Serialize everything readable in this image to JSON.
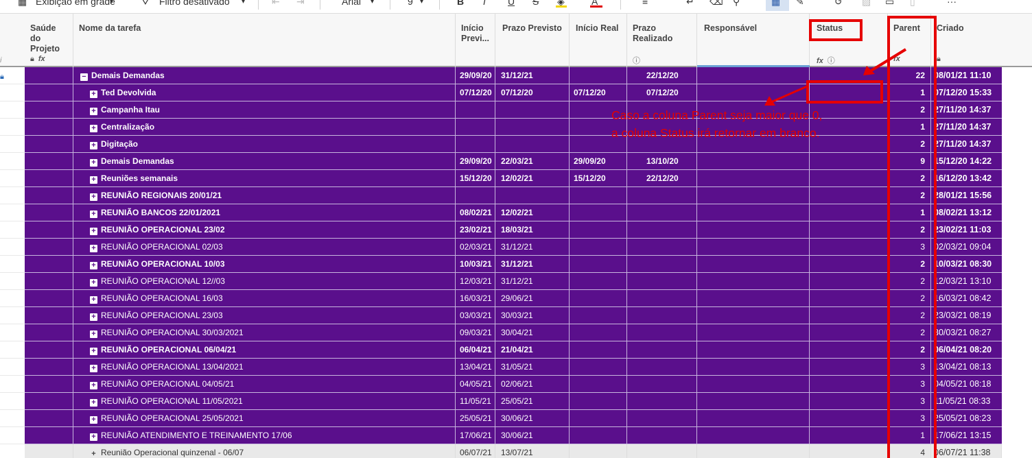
{
  "toolbar": {
    "view_label": "Exibição em grade",
    "filter_label": "Filtro desativado",
    "font_label": "Arial",
    "size_label": "9",
    "bold_label": "B",
    "italic_label": "I",
    "underline_label": "U",
    "strike_label": "S",
    "text_color_label": "A"
  },
  "columns": {
    "saude": "Saúde do Projeto",
    "nome": "Nome da tarefa",
    "inicio_previsto": "Início Previ...",
    "prazo_previsto": "Prazo Previsto",
    "inicio_real": "Início Real",
    "prazo_realizado": "Prazo Realizado",
    "responsavel": "Responsável",
    "status": "Status",
    "parent": "Parent",
    "criado": "Criado"
  },
  "rows": [
    {
      "nome": "Demais Demandas",
      "toggle": "−",
      "inicio": "29/09/20",
      "prazo": "31/12/21",
      "real": "",
      "realizado": "22/12/20",
      "parent": "22",
      "criado": "08/01/21 11:10",
      "bold": true,
      "top": true
    },
    {
      "nome": "Ted Devolvida",
      "toggle": "+",
      "inicio": "07/12/20",
      "prazo": "07/12/20",
      "real": "07/12/20",
      "realizado": "07/12/20",
      "parent": "1",
      "criado": "07/12/20 15:33",
      "bold": true
    },
    {
      "nome": "Campanha Itau",
      "toggle": "+",
      "inicio": "",
      "prazo": "",
      "real": "",
      "realizado": "",
      "parent": "2",
      "criado": "27/11/20 14:37",
      "bold": true
    },
    {
      "nome": "Centralização",
      "toggle": "+",
      "inicio": "",
      "prazo": "",
      "real": "",
      "realizado": "",
      "parent": "1",
      "criado": "27/11/20 14:37",
      "bold": true
    },
    {
      "nome": "Digitação",
      "toggle": "+",
      "inicio": "",
      "prazo": "",
      "real": "",
      "realizado": "",
      "parent": "2",
      "criado": "27/11/20 14:37",
      "bold": true
    },
    {
      "nome": "Demais Demandas",
      "toggle": "+",
      "inicio": "29/09/20",
      "prazo": "22/03/21",
      "real": "29/09/20",
      "realizado": "13/10/20",
      "parent": "9",
      "criado": "15/12/20 14:22",
      "bold": true
    },
    {
      "nome": "Reuniões semanais",
      "toggle": "+",
      "inicio": "15/12/20",
      "prazo": "12/02/21",
      "real": "15/12/20",
      "realizado": "22/12/20",
      "parent": "2",
      "criado": "16/12/20 13:42",
      "bold": true
    },
    {
      "nome": "REUNIÃO REGIONAIS 20/01/21",
      "toggle": "+",
      "inicio": "",
      "prazo": "",
      "real": "",
      "realizado": "",
      "parent": "2",
      "criado": "28/01/21 15:56",
      "bold": true
    },
    {
      "nome": "REUNIÃO BANCOS 22/01/2021",
      "toggle": "+",
      "inicio": "08/02/21",
      "prazo": "12/02/21",
      "real": "",
      "realizado": "",
      "parent": "1",
      "criado": "08/02/21 13:12",
      "bold": true
    },
    {
      "nome": "REUNIÃO OPERACIONAL 23/02",
      "toggle": "+",
      "inicio": "23/02/21",
      "prazo": "18/03/21",
      "real": "",
      "realizado": "",
      "parent": "2",
      "criado": "23/02/21 11:03",
      "bold": true
    },
    {
      "nome": "REUNIÃO OPERACIONAL 02/03",
      "toggle": "+",
      "inicio": "02/03/21",
      "prazo": "31/12/21",
      "real": "",
      "realizado": "",
      "parent": "3",
      "criado": "02/03/21 09:04",
      "bold": false
    },
    {
      "nome": "REUNIÃO OPERACIONAL 10/03",
      "toggle": "+",
      "inicio": "10/03/21",
      "prazo": "31/12/21",
      "real": "",
      "realizado": "",
      "parent": "2",
      "criado": "10/03/21 08:30",
      "bold": true
    },
    {
      "nome": "REUNIÃO OPERACIONAL 12//03",
      "toggle": "+",
      "inicio": "12/03/21",
      "prazo": "31/12/21",
      "real": "",
      "realizado": "",
      "parent": "2",
      "criado": "12/03/21 13:10",
      "bold": false
    },
    {
      "nome": "REUNIÃO OPERACIONAL 16/03",
      "toggle": "+",
      "inicio": "16/03/21",
      "prazo": "29/06/21",
      "real": "",
      "realizado": "",
      "parent": "2",
      "criado": "16/03/21 08:42",
      "bold": false
    },
    {
      "nome": "REUNIÃO OPERACIONAL 23/03",
      "toggle": "+",
      "inicio": "03/03/21",
      "prazo": "30/03/21",
      "real": "",
      "realizado": "",
      "parent": "2",
      "criado": "23/03/21 08:19",
      "bold": false
    },
    {
      "nome": "REUNIÃO OPERACIONAL 30/03/2021",
      "toggle": "+",
      "inicio": "09/03/21",
      "prazo": "30/04/21",
      "real": "",
      "realizado": "",
      "parent": "2",
      "criado": "30/03/21 08:27",
      "bold": false
    },
    {
      "nome": "REUNIÃO OPERACIONAL 06/04/21",
      "toggle": "+",
      "inicio": "06/04/21",
      "prazo": "21/04/21",
      "real": "",
      "realizado": "",
      "parent": "2",
      "criado": "06/04/21 08:20",
      "bold": true
    },
    {
      "nome": "REUNIÃO OPERACIONAL 13/04/2021",
      "toggle": "+",
      "inicio": "13/04/21",
      "prazo": "31/05/21",
      "real": "",
      "realizado": "",
      "parent": "3",
      "criado": "13/04/21 08:13",
      "bold": false
    },
    {
      "nome": "REUNIÃO OPERACIONAL 04/05/21",
      "toggle": "+",
      "inicio": "04/05/21",
      "prazo": "02/06/21",
      "real": "",
      "realizado": "",
      "parent": "3",
      "criado": "04/05/21 08:18",
      "bold": false
    },
    {
      "nome": "REUNIÃO OPERACIONAL 11/05/2021",
      "toggle": "+",
      "inicio": "11/05/21",
      "prazo": "25/05/21",
      "real": "",
      "realizado": "",
      "parent": "3",
      "criado": "11/05/21 08:33",
      "bold": false
    },
    {
      "nome": "REUNIÃO OPERACIONAL 25/05/2021",
      "toggle": "+",
      "inicio": "25/05/21",
      "prazo": "30/06/21",
      "real": "",
      "realizado": "",
      "parent": "3",
      "criado": "25/05/21 08:23",
      "bold": false
    },
    {
      "nome": "REUNIÃO ATENDIMENTO E TREINAMENTO 17/06",
      "toggle": "+",
      "inicio": "17/06/21",
      "prazo": "30/06/21",
      "real": "",
      "realizado": "",
      "parent": "1",
      "criado": "17/06/21 13:15",
      "bold": false
    },
    {
      "nome": "Reunião Operacional quinzenal - 06/07",
      "toggle": "+",
      "inicio": "06/07/21",
      "prazo": "13/07/21",
      "real": "",
      "realizado": "",
      "parent": "4",
      "criado": "06/07/21 11:38",
      "bold": false,
      "light": true
    }
  ],
  "annotation": {
    "line1": "Caso a coluna Parent seja maior que 0,",
    "line2": "a coluna Status irá retornar em branco."
  },
  "colors": {
    "row_purple": "#5a0f8c",
    "annotation_red": "#e60000"
  }
}
